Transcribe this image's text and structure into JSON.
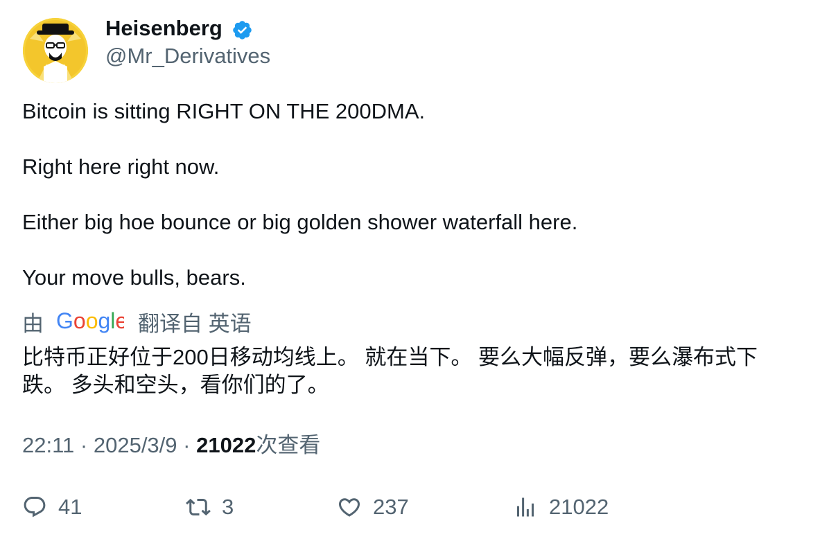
{
  "author": {
    "display_name": "Heisenberg",
    "handle": "@Mr_Derivatives",
    "verified_icon": "verified-badge-icon",
    "badge_color": "#1d9bf0"
  },
  "tweet": {
    "lines": [
      "Bitcoin is sitting RIGHT ON THE 200DMA.",
      "Right here right now.",
      "Either big hoe bounce or big golden shower waterfall here.",
      "Your move bulls, bears."
    ]
  },
  "translation": {
    "prefix": "由",
    "provider": "Google",
    "suffix": "翻译自 英语",
    "text": "比特币正好位于200日移动均线上。 就在当下。 要么大幅反弹，要么瀑布式下跌。 多头和空头，看你们的了。"
  },
  "meta": {
    "time": "22:11",
    "separator": "·",
    "date": "2025/3/9",
    "views": "21022",
    "views_label": "次查看"
  },
  "actions": {
    "replies": "41",
    "retweets": "3",
    "likes": "237",
    "views": "21022"
  },
  "colors": {
    "text": "#0f1419",
    "secondary": "#536471",
    "avatar_bg": "#f7d23a"
  }
}
